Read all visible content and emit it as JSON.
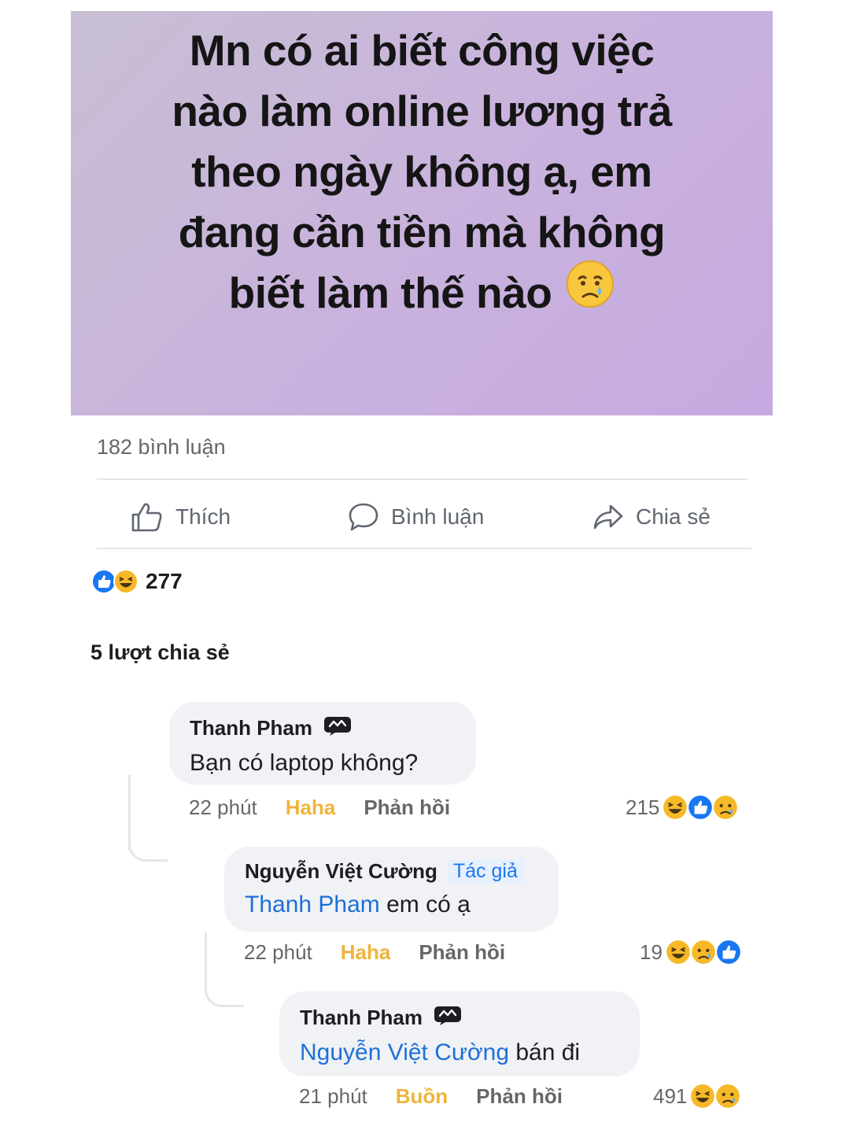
{
  "post": {
    "lines": [
      "Mn có ai biết công việc",
      "nào làm online lương trả",
      "theo ngày không ạ, em",
      "đang cần tiền mà không",
      "biết làm thế nào"
    ],
    "emoji": "crying-face"
  },
  "stats": {
    "comments": "182 bình luận",
    "reactions_count": "277",
    "shares": "5 lượt chia sẻ"
  },
  "actions": {
    "like": "Thích",
    "comment": "Bình luận",
    "share": "Chia sẻ"
  },
  "comments": [
    {
      "author": "Thanh Pham",
      "text": "Bạn có laptop không?",
      "time": "22 phút",
      "reaction_label": "Haha",
      "reply_label": "Phản hồi",
      "reaction_count": "215",
      "reactions": [
        "haha",
        "like",
        "sad"
      ]
    },
    {
      "author": "Nguyễn Việt Cường",
      "role": "Tác giả",
      "mention": "Thanh Pham",
      "text": " em có ạ",
      "time": "22 phút",
      "reaction_label": "Haha",
      "reply_label": "Phản hồi",
      "reaction_count": "19",
      "reactions": [
        "haha",
        "sad",
        "like"
      ]
    },
    {
      "author": "Thanh Pham",
      "mention": "Nguyễn Việt Cường",
      "text": " bán đi",
      "time": "21 phút",
      "reaction_label": "Buồn",
      "reply_label": "Phản hồi",
      "reaction_count": "491",
      "reactions": [
        "haha",
        "sad"
      ]
    }
  ],
  "colors": {
    "like_blue": "#1877f2",
    "haha_yellow": "#f7b928",
    "mention_blue": "#1d6fd8",
    "bubble_bg": "#f0f2f5"
  }
}
